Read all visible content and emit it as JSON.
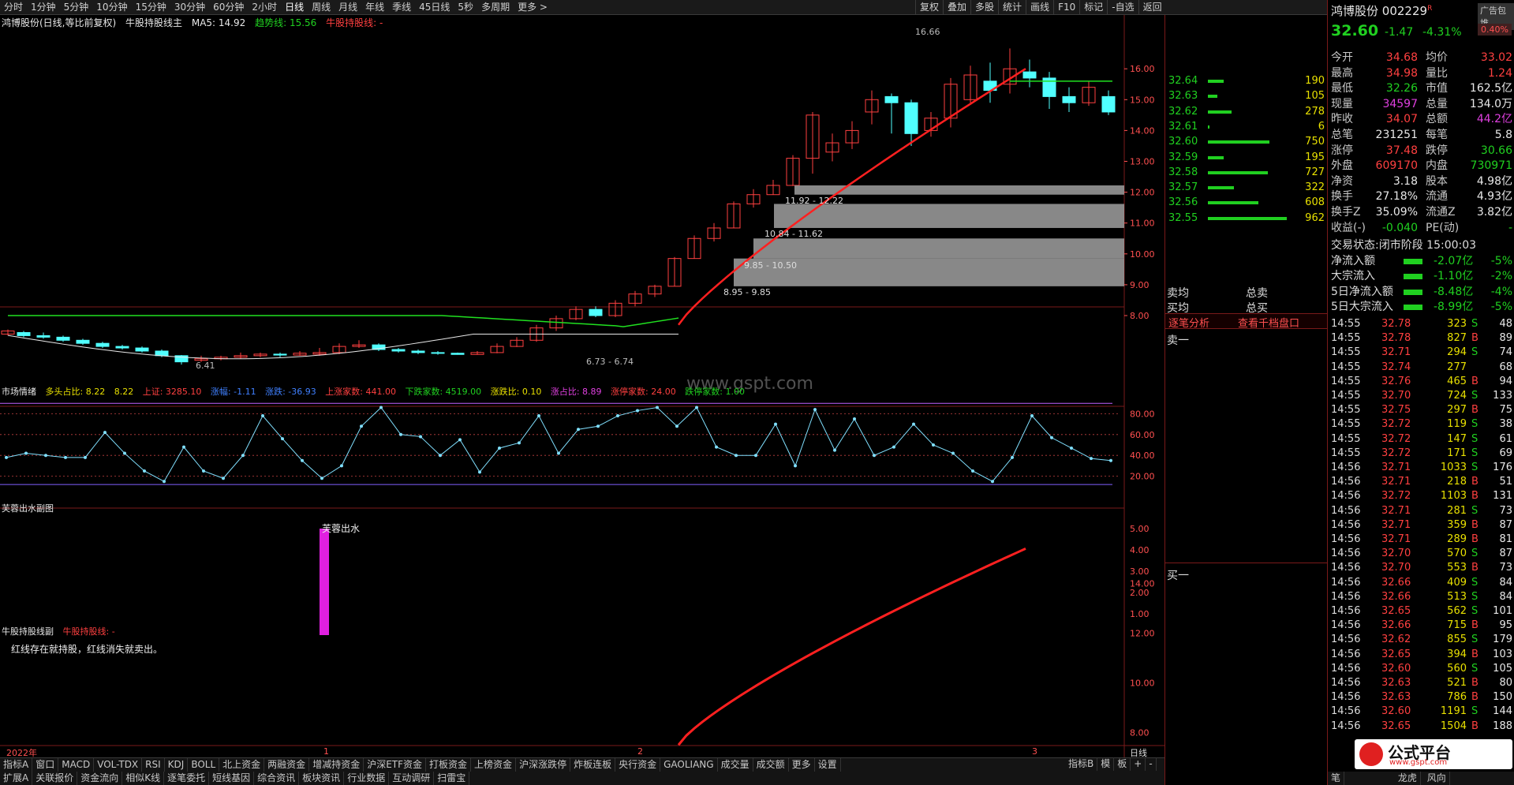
{
  "toolbar": {
    "periods": [
      "分时",
      "1分钟",
      "5分钟",
      "10分钟",
      "15分钟",
      "30分钟",
      "60分钟",
      "2小时",
      "日线",
      "周线",
      "月线",
      "年线",
      "季线",
      "45日线",
      "5秒",
      "多周期",
      "更多 >"
    ],
    "tools": [
      "复权",
      "叠加",
      "多股",
      "统计",
      "画线",
      "F10",
      "标记",
      "-自选",
      "返回"
    ]
  },
  "main_chart": {
    "title": "鸿博股份(日线,等比前复权)",
    "indicator": "牛股持股线主",
    "ma5": "MA5: 14.92",
    "trend": "趋势线: 15.56",
    "hold": "牛股持股线: -",
    "y_ticks": [
      "16.00",
      "15.00",
      "14.00",
      "13.00",
      "12.00",
      "11.00",
      "10.00",
      "9.00",
      "8.00"
    ],
    "price_labels": {
      "high": "16.66",
      "low": "6.41",
      "range1": "6.73 - 6.74",
      "gap1": "8.95 - 9.85",
      "gap2": "9.85 - 10.50",
      "gap3": "10.84 - 11.62",
      "gap4": "11.92 - 12.22"
    },
    "watermark": "www.gspt.com"
  },
  "sentiment": {
    "title": "市场情绪",
    "items": [
      "多头占比: 8.22",
      "8.22",
      "上证: 3285.10",
      "涨幅: -1.11",
      "涨跌: -36.93",
      "上涨家数: 441.00",
      "下跌家数: 4519.00",
      "涨跌比: 0.10",
      "涨占比: 8.89",
      "涨停家数: 24.00",
      "跌停家数: 1.00"
    ],
    "y_ticks": [
      "80.00",
      "60.00",
      "40.00",
      "20.00"
    ]
  },
  "furong": {
    "title": "芙蓉出水副图",
    "label": "芙蓉出水",
    "y_ticks": [
      "5.00",
      "4.00",
      "3.00",
      "2.00",
      "1.00"
    ]
  },
  "hold_sub": {
    "title": "牛股持股线副",
    "hold": "牛股持股线: -",
    "note": "红线存在就持股，红线消失就卖出。",
    "y_ticks": [
      "14.00",
      "12.00",
      "10.00",
      "8.00"
    ]
  },
  "x_axis": {
    "year": "2022年",
    "marks": [
      "1",
      "2",
      "3"
    ],
    "period": "日线"
  },
  "bottom_tabs1": [
    "指标A",
    "窗口",
    "MACD",
    "VOL-TDX",
    "RSI",
    "KDJ",
    "BOLL",
    "北上资金",
    "两融资金",
    "增减持资金",
    "沪深ETF资金",
    "打板资金",
    "上榜资金",
    "沪深涨跌停",
    "炸板连板",
    "央行资金",
    "GAOLIANG",
    "成交量",
    "成交额",
    "更多",
    "设置"
  ],
  "bottom_tabs1_right": [
    "指标B",
    "模",
    "板",
    "+",
    "-"
  ],
  "bottom_tabs2": [
    "扩展A",
    "关联报价",
    "资金流向",
    "相似K线",
    "逐笔委托",
    "短线基因",
    "综合资讯",
    "板块资讯",
    "行业数据",
    "互动调研",
    "扫雷宝"
  ],
  "depth": {
    "rows": [
      {
        "price": "32.64",
        "qty": "190",
        "bar": 0.2
      },
      {
        "price": "32.63",
        "qty": "105",
        "bar": 0.12
      },
      {
        "price": "32.62",
        "qty": "278",
        "bar": 0.3
      },
      {
        "price": "32.61",
        "qty": "6",
        "bar": 0.02
      },
      {
        "price": "32.60",
        "qty": "750",
        "bar": 0.78
      },
      {
        "price": "32.59",
        "qty": "195",
        "bar": 0.2
      },
      {
        "price": "32.58",
        "qty": "727",
        "bar": 0.76
      },
      {
        "price": "32.57",
        "qty": "322",
        "bar": 0.33
      },
      {
        "price": "32.56",
        "qty": "608",
        "bar": 0.64
      },
      {
        "price": "32.55",
        "qty": "962",
        "bar": 1.0
      }
    ],
    "sell_avg": "卖均",
    "buy_avg": "买均",
    "total_sell": "总卖",
    "total_buy": "总买",
    "tick_analysis": "逐笔分析",
    "thousand": "查看千档盘口",
    "sell1": "卖一",
    "buy1": "买一"
  },
  "quote": {
    "name": "鸿博股份",
    "code": "002229",
    "badge": "R",
    "ad": "广告包堆",
    "ad_pct": "0.40%",
    "price": "32.60",
    "change": "-1.47",
    "change_pct": "-4.31%",
    "rows": [
      [
        "今开",
        "34.68",
        "均价",
        "33.02"
      ],
      [
        "最高",
        "34.98",
        "量比",
        "1.24"
      ],
      [
        "最低",
        "32.26",
        "市值",
        "162.5亿"
      ],
      [
        "现量",
        "34597",
        "总量",
        "134.0万"
      ],
      [
        "昨收",
        "34.07",
        "总额",
        "44.2亿"
      ],
      [
        "总笔",
        "231251",
        "每笔",
        "5.8"
      ],
      [
        "涨停",
        "37.48",
        "跌停",
        "30.66"
      ],
      [
        "外盘",
        "609170",
        "内盘",
        "730971"
      ],
      [
        "净资",
        "3.18",
        "股本",
        "4.98亿"
      ],
      [
        "换手",
        "27.18%",
        "流通",
        "4.93亿"
      ],
      [
        "换手Z",
        "35.09%",
        "流通Z",
        "3.82亿"
      ],
      [
        "收益(-)",
        "-0.040",
        "PE(动)",
        "-"
      ]
    ],
    "status_label": "交易状态:",
    "status": "闭市阶段 15:00:03",
    "flows": [
      [
        "净流入额",
        "-2.07亿",
        "-5%"
      ],
      [
        "大宗流入",
        "-1.10亿",
        "-2%"
      ],
      [
        "5日净流入额",
        "-8.48亿",
        "-4%"
      ],
      [
        "5日大宗流入",
        "-8.99亿",
        "-5%"
      ]
    ],
    "ticks": [
      [
        "14:55",
        "32.78",
        "323",
        "S",
        "48"
      ],
      [
        "14:55",
        "32.78",
        "827",
        "B",
        "89"
      ],
      [
        "14:55",
        "32.71",
        "294",
        "S",
        "74"
      ],
      [
        "14:55",
        "32.74",
        "277",
        "",
        "68"
      ],
      [
        "14:55",
        "32.76",
        "465",
        "B",
        "94"
      ],
      [
        "14:55",
        "32.70",
        "724",
        "S",
        "133"
      ],
      [
        "14:55",
        "32.75",
        "297",
        "B",
        "75"
      ],
      [
        "14:55",
        "32.72",
        "119",
        "S",
        "38"
      ],
      [
        "14:55",
        "32.72",
        "147",
        "S",
        "61"
      ],
      [
        "14:55",
        "32.72",
        "171",
        "S",
        "69"
      ],
      [
        "14:56",
        "32.71",
        "1033",
        "S",
        "176"
      ],
      [
        "14:56",
        "32.71",
        "218",
        "B",
        "51"
      ],
      [
        "14:56",
        "32.72",
        "1103",
        "B",
        "131"
      ],
      [
        "14:56",
        "32.71",
        "281",
        "S",
        "73"
      ],
      [
        "14:56",
        "32.71",
        "359",
        "B",
        "87"
      ],
      [
        "14:56",
        "32.71",
        "289",
        "B",
        "81"
      ],
      [
        "14:56",
        "32.70",
        "570",
        "S",
        "87"
      ],
      [
        "14:56",
        "32.70",
        "553",
        "B",
        "73"
      ],
      [
        "14:56",
        "32.66",
        "409",
        "S",
        "84"
      ],
      [
        "14:56",
        "32.66",
        "513",
        "S",
        "84"
      ],
      [
        "14:56",
        "32.65",
        "562",
        "S",
        "101"
      ],
      [
        "14:56",
        "32.66",
        "715",
        "B",
        "95"
      ],
      [
        "14:56",
        "32.62",
        "855",
        "S",
        "179"
      ],
      [
        "14:56",
        "32.65",
        "394",
        "B",
        "103"
      ],
      [
        "14:56",
        "32.60",
        "560",
        "S",
        "105"
      ],
      [
        "14:56",
        "32.63",
        "521",
        "B",
        "80"
      ],
      [
        "14:56",
        "32.63",
        "786",
        "B",
        "150"
      ],
      [
        "14:56",
        "32.60",
        "1191",
        "S",
        "144"
      ],
      [
        "14:56",
        "32.65",
        "1504",
        "B",
        "188"
      ]
    ],
    "footer_tabs": [
      "笔",
      "龙虎",
      "风向"
    ],
    "logo": "公式平台",
    "logo_url": "www.gspt.com"
  }
}
